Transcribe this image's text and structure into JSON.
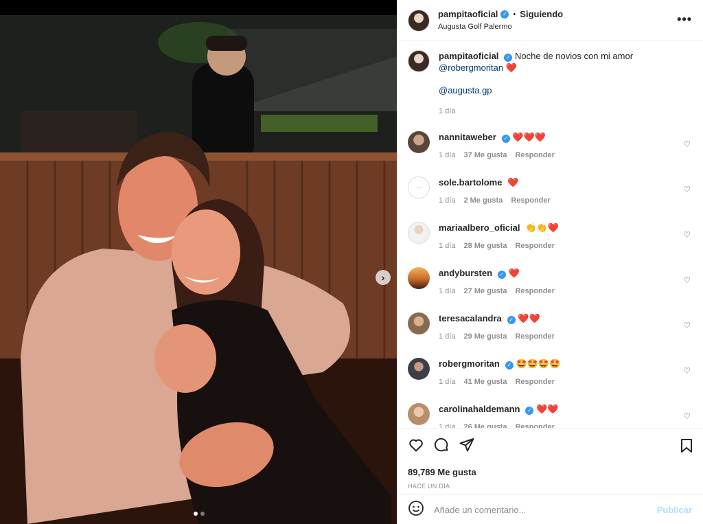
{
  "post": {
    "author": "pampitaoficial",
    "follow_sep": "•",
    "follow_status": "Siguiendo",
    "location": "Augusta Golf Palermo",
    "more": "•••"
  },
  "caption": {
    "author": "pampitaoficial",
    "text": "Noche de novios con mi amor",
    "mention1": "@robergmoritan",
    "mention1_emoji": "❤️",
    "mention2": "@augusta.gp",
    "time": "1 día"
  },
  "comments": [
    {
      "user": "nannitaweber",
      "verified": true,
      "text": "❤️❤️❤️",
      "time": "1 día",
      "likes": "37 Me gusta",
      "reply": "Responder"
    },
    {
      "user": "sole.bartolome",
      "verified": false,
      "text": "❤️",
      "time": "1 día",
      "likes": "2 Me gusta",
      "reply": "Responder"
    },
    {
      "user": "mariaalbero_oficial",
      "verified": false,
      "text": "👏👏❤️",
      "time": "1 día",
      "likes": "28 Me gusta",
      "reply": "Responder"
    },
    {
      "user": "andybursten",
      "verified": true,
      "text": "❤️",
      "time": "1 día",
      "likes": "27 Me gusta",
      "reply": "Responder"
    },
    {
      "user": "teresacalandra",
      "verified": true,
      "text": "❤️❤️",
      "time": "1 día",
      "likes": "29 Me gusta",
      "reply": "Responder"
    },
    {
      "user": "robergmoritan",
      "verified": true,
      "text": "🤩🤩🤩🤩",
      "time": "1 día",
      "likes": "41 Me gusta",
      "reply": "Responder"
    },
    {
      "user": "carolinahaldemann",
      "verified": true,
      "text": "❤️❤️",
      "time": "1 día",
      "likes": "26 Me gusta",
      "reply": "Responder"
    }
  ],
  "stats": {
    "likes": "89,789 Me gusta",
    "ago": "HACE UN DÍA"
  },
  "composer": {
    "placeholder": "Añade un comentario...",
    "publish": "Publicar"
  },
  "carousel": {
    "next": "›"
  }
}
